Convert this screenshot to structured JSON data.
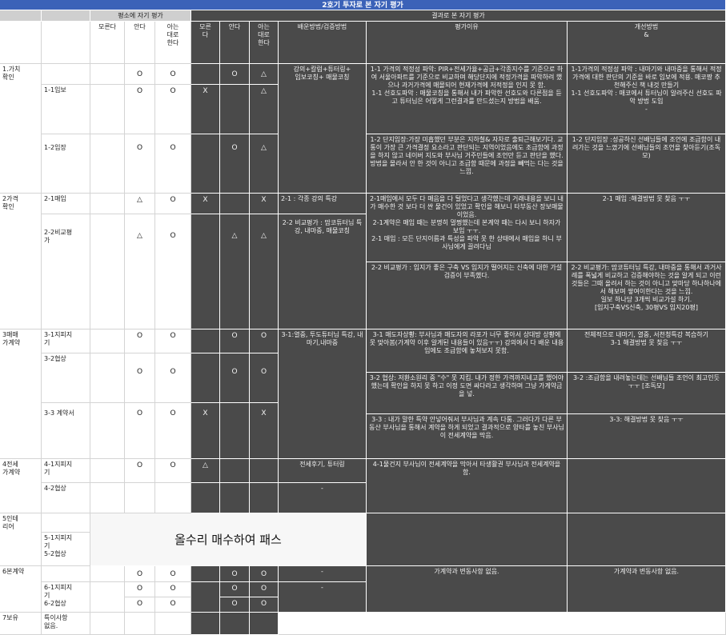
{
  "title": "2호기 투자로 본 자기 평가",
  "headers": {
    "before_group": "평소에 자기 평가",
    "after_group": "결과로 본 자기 평가",
    "dont_know": "모른다",
    "know": "안다",
    "know_as_is": "아는\n대로\n한다",
    "after_dont_know": "모른\n다",
    "after_know": "안다",
    "after_know_as_is": "아는\n대로\n한다",
    "method": "배운방법/검증방법",
    "reason": "평가이유",
    "improve": "개선방법\n&"
  },
  "marks": {
    "o": "O",
    "tri": "△",
    "x": "X"
  },
  "rows": {
    "r1_label": "1.가치\n확인",
    "r1_1_label": "1-1임보",
    "r1_2_label": "1-2임장",
    "r1_method": "강의+칼럼+튜터링+\n임보코칭+ 매물코칭",
    "r1_reason_a": "1-1 가격의 적정성 파악: PIR+전세가율+공급+각종지수를 기준으로 하여 서울아파트를 기준으로 비교하며 해당단지에 적정가격을 파악하려 했으나 과거가격에 매몰되어 현재가격에 저적정을 인지 못 함.\n1-1 선호도파악 : 매물코칭을 통해서 내가 파악한 선호도와 다른점을 듣고 튜터님은 어떻게 그런결과를 만드셨는지 방법을 배움.",
    "r1_improve_a": "1-1가격의 적정성 파악 : 내마기와 내마중을 통해서 적정가격에 대한 판단의 기준을 바로 임보에 적용. 매코짱 추천해주신 책 내것 만들기\n1-1 선호도파악 : 매코에서 튜터님이 알려주신 선호도 파악 방법 도입\n-",
    "r1_reason_b": "1-2 단지임장:가장 미흡했던 부분은 지하철& 자차로 출퇴근해보기다. 교통이 가장 큰 가격결정 요소라고 판단되는 지역이었음에도 조급함에 과정을 하지 않고 네이버 지도와 부사님 거주민들에 조언만 듣고 판단을 했다. 방법을 몰라서 안 한 것이 아니고 조급함 때문에 과정을 빼먹는 다는 것을 느낌.",
    "r1_improve_b": "1-2  단지임장 :성공하신 선배님들에 조언에 조급함이 내려가는 것을 느꼈기에 선배님들의 조언을 찾아듣기(조독모)",
    "r2_label": "2가격\n확인",
    "r2_1_label": "2-1매임",
    "r2_2_label": "2-2비교평\n가",
    "r2_method_a": "2-1 : 각종 강의 특강",
    "r2_method_b": "2-2 비교평가 : 맘코튜터님 특강, 내마중, 매물코칭",
    "r2_reason_a": "2-1매임에서 모두 다 매음을 다 털었다고 생각했는데 거래내용을 보니 내가 매수한 것 보다 더 싼 물건이 있었고 확인을 해보니 타부동산 장보매물이었음.\n2-1계약은 매임 때는 분명히 멀쩡했는데 본계약 때는 다시 보니 하자가 보임 ㅜㅜ.\n2-1 매임 : 모든 단지이름과 특성을 파악 못 한 상태에서 매임을 하니 부사님에게 끌려다님",
    "r2_improve_a": "2-1 매임 :해결방법 못 찾음 ㅜㅜ",
    "r2_reason_b": "2-2 비교평가 : 입지가 좋은 구축 VS 입지가 떨어지는 신축에 대한 가설검증이 부족했다.",
    "r2_improve_b": "2-2 비교평가: 맘코튜터님 특강, 내마중을 통해서 과거사례를 폭넓게 비교하고 검증해야하는 것을 알게 되고 이런 것들은 그때 올려서 하는 것이 아니고 맞마당 하나하나에 서 해보며 쌓여이한다는 것을 느낌.\n일보 하나당 3개씩 비교가설 하기.\n[입지구축VS신축, 30평VS 입지20평]",
    "r3_label": "3매매\n가계약",
    "r3_1_label": "3-1지피지\n기",
    "r3_2_label": "3-2협상",
    "r3_3_label": "3-3 계약서",
    "r3_method": "3-1:열중, 투도튜터님 특강, 내마기,내마중",
    "r3_reason_a": "3-1 매도자상황: 부사님과 매도자의 라포가 너무 좋아서 상대방 상황에 못 맞아봄(가계약 이후 알게된 내용들이 있음ㅜㅜ) 강의에서 다 배운 내용임에도 조급함에 놓쳐보지 못함.",
    "r3_improve_a": "전체적으로 내마기, 열중, 서천청특강 복습하기\n3-1 해결방법 못 찾음 ㅜㅜ",
    "r3_reason_b": "3-2 협상: 저환소원리 중 \"수\" 못 지킴. 내가 정한 가격까지네고를 했어야 했는데 확인을 하지 못 하고 이정 도면 싸다라고 생각하며 그냥 가계약금을 넣.",
    "r3_improve_b": "3-2 :조급함을 내려놓는데는 선배님들 조언이 최고인듯 ㅜㅜ [조독모]",
    "r3_reason_c": "3-3 : 내가 말한 특약 안넣어줘서 부사님과 계속 다툼. 그러다가 다른 부동산 부사님을 통해서 계약을 하게 되었고 결과적으로 양타를 놓친 부사님이 전세계약을 막음.",
    "r3_improve_c": "3-3: 해결방법 못 찾음 ㅜㅜ",
    "r4_label": "4전세\n가계약",
    "r4_1_label": "4-1지피지\n기",
    "r4_2_label": "4-2협상",
    "r4_method_a": "전세후기, 튜터링",
    "r4_method_b": "-",
    "r4_reason": "4-1물건지 부사님이 전세계약을 막아서 타생활권 부사님과 전세계약을 함.",
    "r5_label": "5인테\n리어",
    "r5_1_label": "5-1지피지\n기",
    "r5_2_label": "5-2협상",
    "r5_note": "올수리 매수하여 패스",
    "r6_label": "6본계약",
    "r6_1_label": "6-1지피지\n기",
    "r6_2_label": "6-2협상",
    "r6_method": "-",
    "r6_method_b": "-",
    "r6_reason": "가계약과 변동사항 없음.",
    "r6_improve": "가계약과 변동사항 없음.",
    "r7_label": "7보유",
    "r7_1_label": "특이사항\n없음."
  }
}
